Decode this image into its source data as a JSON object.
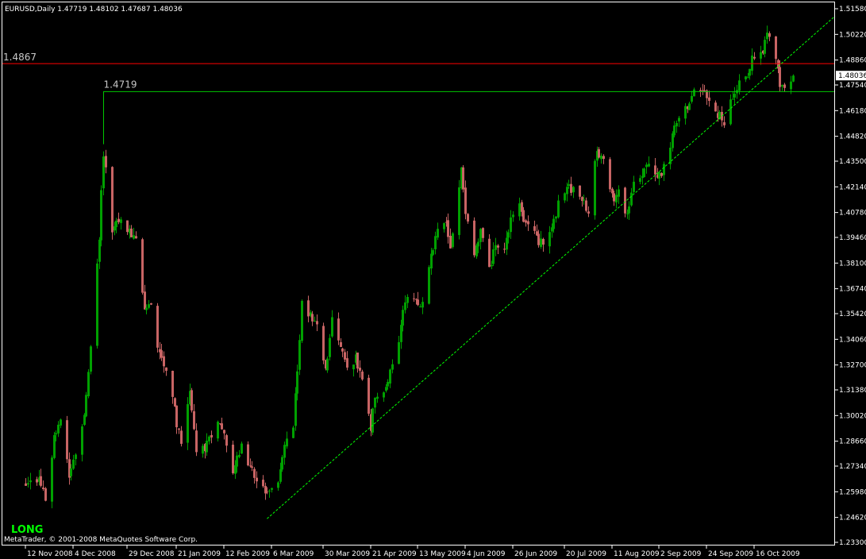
{
  "window": {
    "header": "EURUSD,Daily  1.47719 1.48102 1.47687 1.48036",
    "strategy_label": "LONG",
    "copyright": "MetaTrader, © 2001-2008 MetaQuotes Software Corp."
  },
  "colors": {
    "background": "#000000",
    "frame": "#ffffff",
    "bull_candle": "#00a000",
    "bear_candle": "#c86464",
    "resistance_line": "#ff0000",
    "support_line": "#00c800",
    "trend_line": "#00ff00",
    "strategy_text": "#00ff00"
  },
  "chart_data": {
    "type": "candlestick",
    "symbol": "EURUSD",
    "timeframe": "Daily",
    "last": {
      "open": 1.47719,
      "high": 1.48102,
      "low": 1.47687,
      "close": 1.48036
    },
    "current_price_label": "1.48036",
    "y_ticks": [
      "1.51580",
      "1.50220",
      "1.48860",
      "1.47540",
      "1.46180",
      "1.44820",
      "1.43500",
      "1.42140",
      "1.40780",
      "1.39460",
      "1.38100",
      "1.36740",
      "1.35420",
      "1.34060",
      "1.32700",
      "1.31380",
      "1.30020",
      "1.28660",
      "1.27340",
      "1.25980",
      "1.24620",
      "1.23300"
    ],
    "ylim": [
      1.233,
      1.5158
    ],
    "x_ticks": [
      "12 Nov 2008",
      "4 Dec 2008",
      "29 Dec 2008",
      "21 Jan 2009",
      "12 Feb 2009",
      "6 Mar 2009",
      "30 Mar 2009",
      "21 Apr 2009",
      "13 May 2009",
      "4 Jun 2009",
      "26 Jun 2009",
      "20 Jul 2009",
      "11 Aug 2009",
      "2 Sep 2009",
      "24 Sep 2009",
      "16 Oct 2009"
    ],
    "horizontal_lines": [
      {
        "label": "1.4867",
        "value": 1.4867,
        "color": "#ff0000"
      },
      {
        "label": "1.4719",
        "value": 1.4719,
        "color": "#00c800"
      }
    ],
    "trend_line": {
      "from": {
        "date": "2009-03-04",
        "price": 1.2455
      },
      "to": {
        "date": "2009-10-30",
        "price": 1.488
      },
      "style": "dashed"
    },
    "close_path": [
      [
        "2008-11-12",
        1.265
      ],
      [
        "2008-11-18",
        1.268
      ],
      [
        "2008-11-21",
        1.254
      ],
      [
        "2008-11-25",
        1.288
      ],
      [
        "2008-11-28",
        1.3
      ],
      [
        "2008-12-02",
        1.27
      ],
      [
        "2008-12-05",
        1.28
      ],
      [
        "2008-12-09",
        1.298
      ],
      [
        "2008-12-12",
        1.338
      ],
      [
        "2008-12-16",
        1.395
      ],
      [
        "2008-12-18",
        1.44
      ],
      [
        "2008-12-22",
        1.398
      ],
      [
        "2008-12-26",
        1.405
      ],
      [
        "2008-12-30",
        1.398
      ],
      [
        "2009-01-02",
        1.392
      ],
      [
        "2009-01-06",
        1.355
      ],
      [
        "2009-01-09",
        1.358
      ],
      [
        "2009-01-13",
        1.332
      ],
      [
        "2009-01-16",
        1.326
      ],
      [
        "2009-01-21",
        1.296
      ],
      [
        "2009-01-23",
        1.285
      ],
      [
        "2009-01-27",
        1.315
      ],
      [
        "2009-01-30",
        1.281
      ],
      [
        "2009-02-04",
        1.285
      ],
      [
        "2009-02-09",
        1.295
      ],
      [
        "2009-02-12",
        1.29
      ],
      [
        "2009-02-16",
        1.272
      ],
      [
        "2009-02-20",
        1.283
      ],
      [
        "2009-02-24",
        1.273
      ],
      [
        "2009-02-27",
        1.268
      ],
      [
        "2009-03-03",
        1.257
      ],
      [
        "2009-03-05",
        1.258
      ],
      [
        "2009-03-09",
        1.262
      ],
      [
        "2009-03-12",
        1.285
      ],
      [
        "2009-03-16",
        1.296
      ],
      [
        "2009-03-18",
        1.325
      ],
      [
        "2009-03-20",
        1.36
      ],
      [
        "2009-03-24",
        1.354
      ],
      [
        "2009-03-27",
        1.349
      ],
      [
        "2009-03-31",
        1.325
      ],
      [
        "2009-04-03",
        1.35
      ],
      [
        "2009-04-07",
        1.335
      ],
      [
        "2009-04-10",
        1.326
      ],
      [
        "2009-04-14",
        1.33
      ],
      [
        "2009-04-17",
        1.317
      ],
      [
        "2009-04-21",
        1.292
      ],
      [
        "2009-04-23",
        1.312
      ],
      [
        "2009-04-27",
        1.312
      ],
      [
        "2009-04-30",
        1.322
      ],
      [
        "2009-05-04",
        1.338
      ],
      [
        "2009-05-07",
        1.363
      ],
      [
        "2009-05-11",
        1.361
      ],
      [
        "2009-05-14",
        1.355
      ],
      [
        "2009-05-18",
        1.378
      ],
      [
        "2009-05-21",
        1.394
      ],
      [
        "2009-05-25",
        1.405
      ],
      [
        "2009-05-28",
        1.39
      ],
      [
        "2009-06-02",
        1.43
      ],
      [
        "2009-06-04",
        1.41
      ],
      [
        "2009-06-08",
        1.385
      ],
      [
        "2009-06-11",
        1.4
      ],
      [
        "2009-06-15",
        1.378
      ],
      [
        "2009-06-18",
        1.392
      ],
      [
        "2009-06-22",
        1.39
      ],
      [
        "2009-06-25",
        1.405
      ],
      [
        "2009-06-29",
        1.41
      ],
      [
        "2009-07-02",
        1.4
      ],
      [
        "2009-07-07",
        1.395
      ],
      [
        "2009-07-10",
        1.39
      ],
      [
        "2009-07-14",
        1.398
      ],
      [
        "2009-07-17",
        1.413
      ],
      [
        "2009-07-21",
        1.422
      ],
      [
        "2009-07-24",
        1.42
      ],
      [
        "2009-07-28",
        1.415
      ],
      [
        "2009-07-31",
        1.41
      ],
      [
        "2009-08-04",
        1.44
      ],
      [
        "2009-08-07",
        1.435
      ],
      [
        "2009-08-11",
        1.415
      ],
      [
        "2009-08-14",
        1.418
      ],
      [
        "2009-08-18",
        1.406
      ],
      [
        "2009-08-21",
        1.425
      ],
      [
        "2009-08-25",
        1.43
      ],
      [
        "2009-08-28",
        1.433
      ],
      [
        "2009-09-01",
        1.425
      ],
      [
        "2009-09-04",
        1.432
      ],
      [
        "2009-09-08",
        1.448
      ],
      [
        "2009-09-11",
        1.458
      ],
      [
        "2009-09-15",
        1.465
      ],
      [
        "2009-09-18",
        1.472
      ],
      [
        "2009-09-22",
        1.472
      ],
      [
        "2009-09-25",
        1.467
      ],
      [
        "2009-09-29",
        1.46
      ],
      [
        "2009-10-02",
        1.455
      ],
      [
        "2009-10-06",
        1.47
      ],
      [
        "2009-10-09",
        1.475
      ],
      [
        "2009-10-13",
        1.482
      ],
      [
        "2009-10-16",
        1.492
      ],
      [
        "2009-10-20",
        1.495
      ],
      [
        "2009-10-22",
        1.502
      ],
      [
        "2009-10-26",
        1.488
      ],
      [
        "2009-10-28",
        1.476
      ],
      [
        "2009-10-30",
        1.476
      ],
      [
        "2009-11-03",
        1.48
      ]
    ]
  }
}
